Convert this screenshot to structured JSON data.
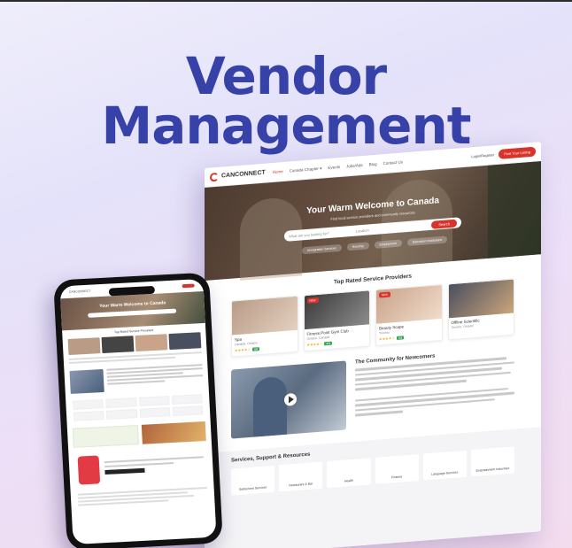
{
  "headline": {
    "line1": "Vendor",
    "line2": "Management"
  },
  "desktop": {
    "logo": "CANCONNECT",
    "nav": [
      "Home",
      "Canada Chapter ▾",
      "Events",
      "Jobs/Ads",
      "Blog",
      "Contact Us"
    ],
    "nav_active_index": 0,
    "right_link": "Login/Register",
    "cta": "Post Your Listing",
    "hero": {
      "title": "Your Warm Welcome to Canada",
      "subtitle": "Find local service providers and community resources",
      "search_placeholder": "What are you looking for?",
      "location_placeholder": "Location",
      "search_button": "Search",
      "chips": [
        "Immigration Services",
        "Housing",
        "Employment",
        "Education Institutions"
      ]
    },
    "providers_title": "Top Rated Service Providers",
    "cards": [
      {
        "name": "Spa",
        "loc": "Canada, Ontario",
        "tag": "",
        "stars": "★★★★☆",
        "rating": "4.0",
        "colors": [
          "#b99b86",
          "#e3d0c0"
        ]
      },
      {
        "name": "Fitness Point Gym Club",
        "loc": "Ontario, Canada",
        "tag": "NEW",
        "stars": "★★★★☆",
        "rating": "4.5",
        "colors": [
          "#3a3a3a",
          "#8c8c8c"
        ]
      },
      {
        "name": "Beauty Scape",
        "loc": "Toronto",
        "tag": "NEW",
        "stars": "★★★★☆",
        "rating": "4.2",
        "colors": [
          "#c9a38a",
          "#f1dccb"
        ]
      },
      {
        "name": "Offline Scientific",
        "loc": "Toronto, Ontario",
        "tag": "",
        "stars": "",
        "rating": "",
        "colors": [
          "#4a4f5f",
          "#caa57b"
        ]
      }
    ],
    "community_title": "The Community for Newcomers",
    "services_title": "Services, Support & Resources",
    "services": [
      {
        "label": "Settlement Services",
        "badge": ""
      },
      {
        "label": "Restaurant & Bar",
        "badge": ""
      },
      {
        "label": "Health",
        "badge": ""
      },
      {
        "label": "Finance",
        "badge": ""
      },
      {
        "label": "Language Services",
        "badge": ""
      },
      {
        "label": "Entertainment Industries",
        "badge": ""
      }
    ]
  },
  "phone": {
    "hero_title": "Your Warm Welcome to Canada",
    "section_title": "Top Rated Service Providers"
  }
}
